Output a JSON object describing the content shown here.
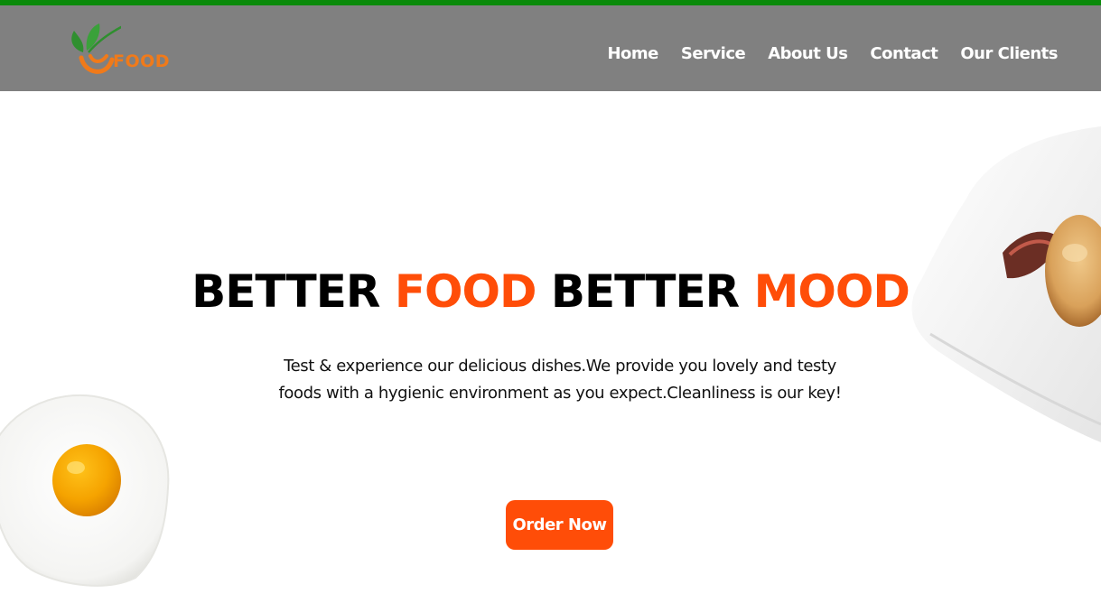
{
  "brand": {
    "logo_text": "FOOD",
    "accent_color": "#ff4d08",
    "top_bar_color": "#0a8a0a",
    "nav_bg_color": "#808080"
  },
  "nav": {
    "items": [
      {
        "label": "Home"
      },
      {
        "label": "Service"
      },
      {
        "label": "About Us"
      },
      {
        "label": "Contact"
      },
      {
        "label": "Our Clients"
      }
    ]
  },
  "hero": {
    "title_part1": "BETTER ",
    "title_part2": "FOOD",
    "title_part3": " BETTER ",
    "title_part4": "MOOD",
    "description": "Test & experience our delicious dishes.We provide you lovely and testy foods with a hygienic environment as you expect.Cleanliness is our key!",
    "cta_label": "Order Now"
  },
  "images": {
    "egg": "fried-egg-icon",
    "plate": "food-plate-icon"
  }
}
